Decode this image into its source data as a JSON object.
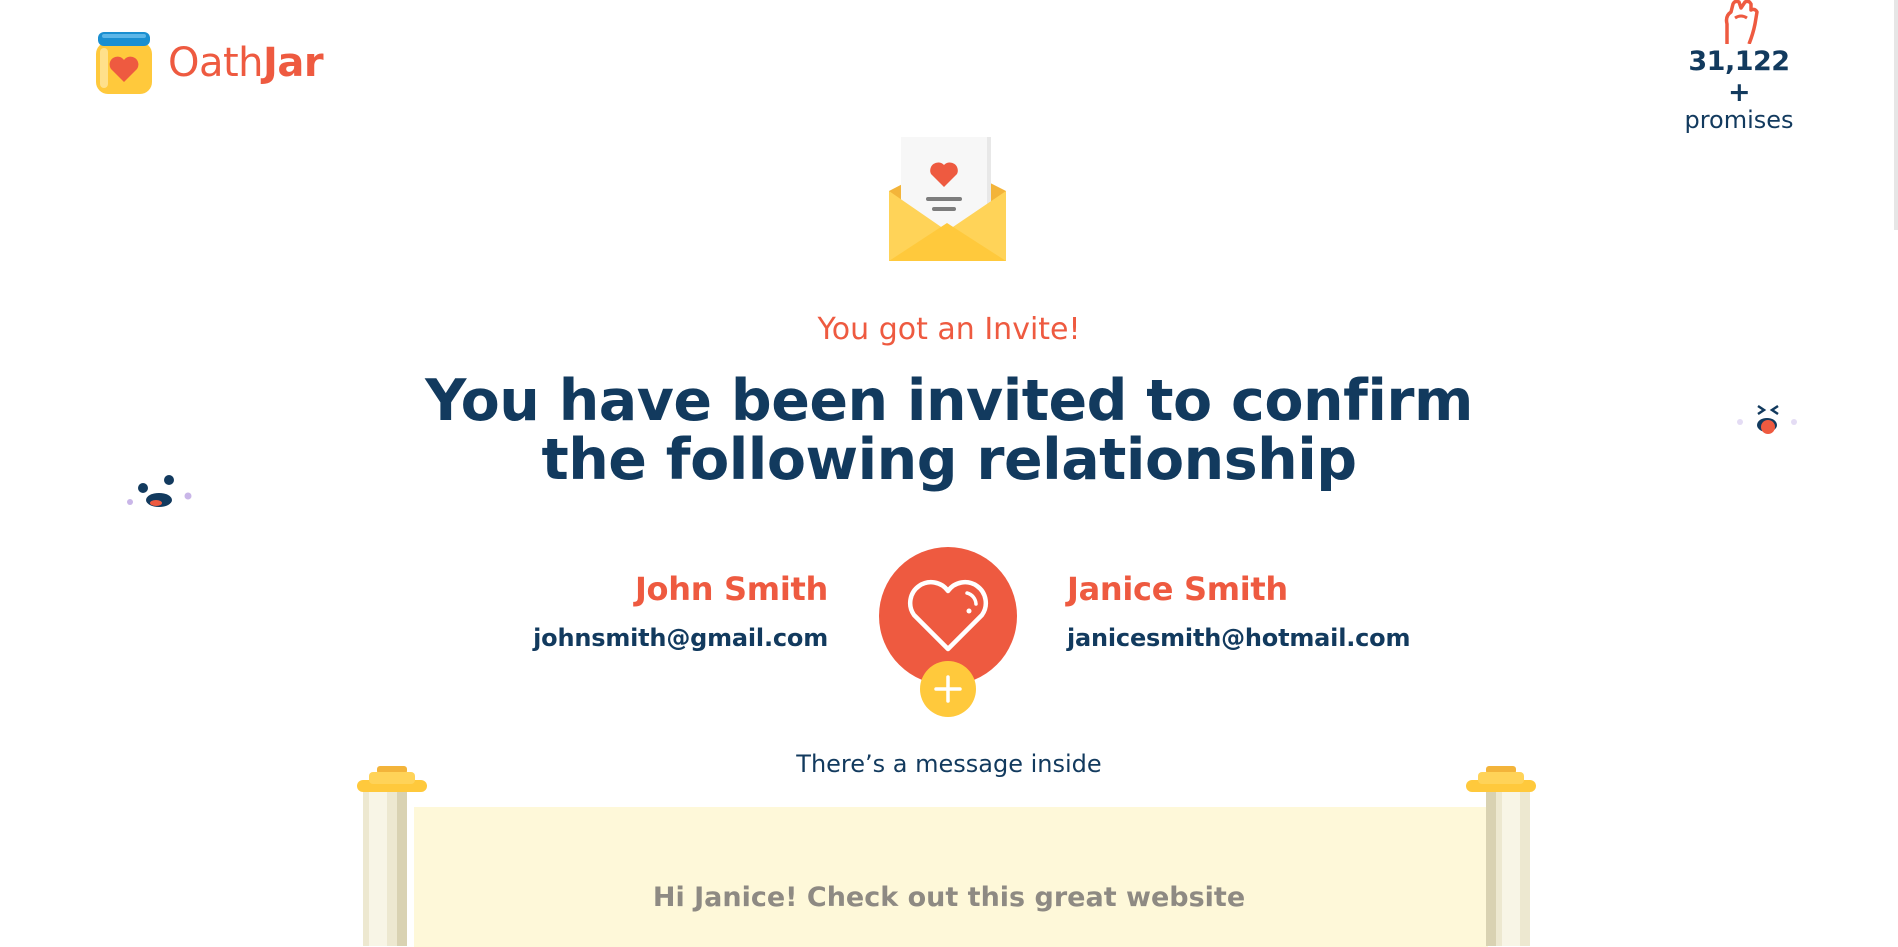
{
  "header": {
    "brand_light": "Oath",
    "brand_bold": "Jar",
    "promise_count": "31,122 +",
    "promise_label": "promises"
  },
  "hero": {
    "kicker": "You got an Invite!",
    "title_line1": "You have been invited to confirm",
    "title_line2": "the following relationship"
  },
  "relationship": {
    "left": {
      "name": "John Smith",
      "email": "johnsmith@gmail.com"
    },
    "right": {
      "name": "Janice Smith",
      "email": "janicesmith@hotmail.com"
    }
  },
  "message": {
    "caption": "There’s a message inside",
    "preview": "Hi Janice! Check out this great website"
  },
  "colors": {
    "brand_coral": "#ee5a40",
    "navy": "#123a5e",
    "yellow": "#ffc93c",
    "paper": "#fef8d9",
    "jar_lid_blue": "#1a8fd1"
  },
  "icons": {
    "logo": "jar-heart-icon",
    "counter": "raised-fist-icon",
    "envelope": "envelope-heart-icon",
    "badge": "heart-icon",
    "add": "plus-icon"
  }
}
